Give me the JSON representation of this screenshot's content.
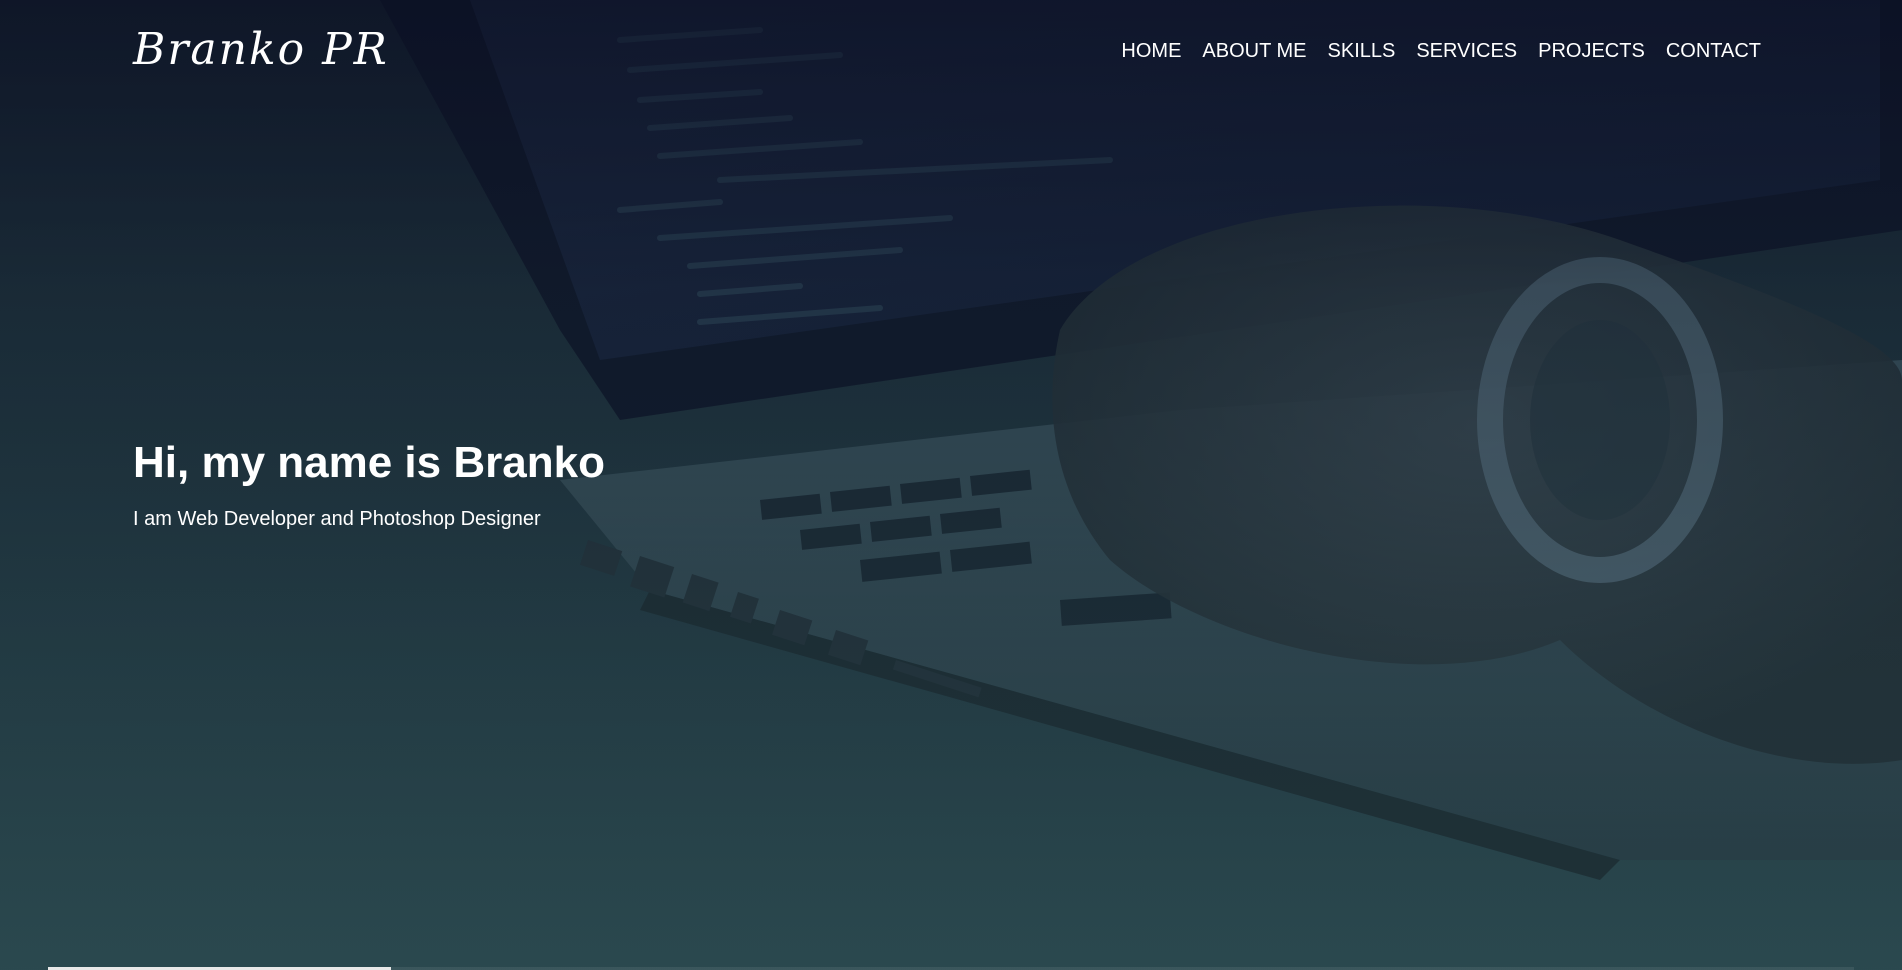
{
  "brand": {
    "logo_text": "Branko PR"
  },
  "nav": {
    "items": [
      "HOME",
      "ABOUT ME",
      "SKILLS",
      "SERVICES",
      "PROJECTS",
      "CONTACT"
    ]
  },
  "hero": {
    "title": "Hi, my name is Branko",
    "subtitle": "I am Web Developer and Photoshop Designer",
    "background_image": "laptop-typing-photo"
  },
  "progress": {
    "fraction": 0.19
  },
  "colors": {
    "text": "#ffffff",
    "overlay_top": "#0a0e22",
    "overlay_bottom": "#274a52"
  }
}
